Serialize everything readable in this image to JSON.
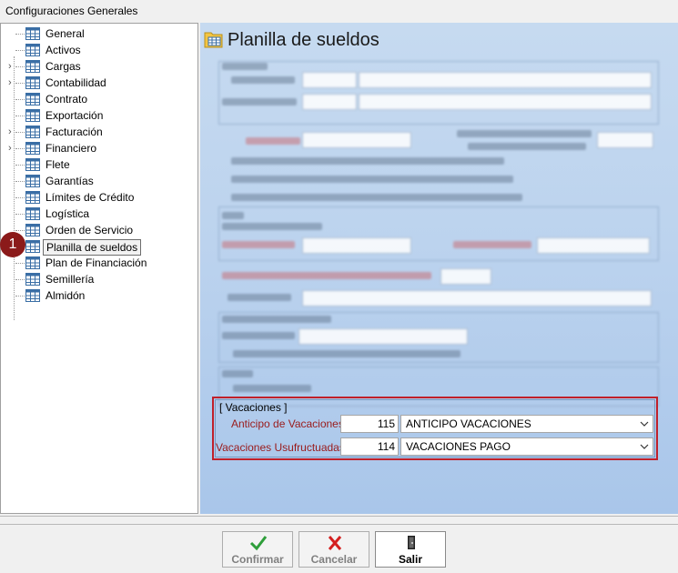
{
  "window": {
    "title": "Configuraciones Generales"
  },
  "tree": {
    "items": [
      {
        "label": "General",
        "expandable": false
      },
      {
        "label": "Activos",
        "expandable": false
      },
      {
        "label": "Cargas",
        "expandable": true
      },
      {
        "label": "Contabilidad",
        "expandable": true
      },
      {
        "label": "Contrato",
        "expandable": false
      },
      {
        "label": "Exportación",
        "expandable": false
      },
      {
        "label": "Facturación",
        "expandable": true
      },
      {
        "label": "Financiero",
        "expandable": true
      },
      {
        "label": "Flete",
        "expandable": false
      },
      {
        "label": "Garantías",
        "expandable": false
      },
      {
        "label": "Límites de Crédito",
        "expandable": false
      },
      {
        "label": "Logística",
        "expandable": false
      },
      {
        "label": "Orden de Servicio",
        "expandable": false
      },
      {
        "label": "Planilla de sueldos",
        "expandable": false,
        "selected": true
      },
      {
        "label": "Plan de Financiación",
        "expandable": false
      },
      {
        "label": "Semillería",
        "expandable": false
      },
      {
        "label": "Almidón",
        "expandable": false
      }
    ],
    "step_badge": "1"
  },
  "panel": {
    "title": "Planilla de sueldos",
    "vacaciones": {
      "group_title": "[ Vacaciones ]",
      "anticipo": {
        "label": "Anticipo de Vacaciones",
        "code": "115",
        "value": "ANTICIPO VACACIONES"
      },
      "usufructuadas": {
        "label": "Vacaciones Usufructuadas",
        "code": "114",
        "value": "VACACIONES PAGO"
      }
    }
  },
  "buttons": {
    "confirmar": "Confirmar",
    "cancelar": "Cancelar",
    "salir": "Salir"
  },
  "colors": {
    "accent_red": "#c0202a",
    "label_red": "#9a1b1b",
    "panel_blue": "#bcd3ee",
    "badge": "#8b1a1a"
  }
}
